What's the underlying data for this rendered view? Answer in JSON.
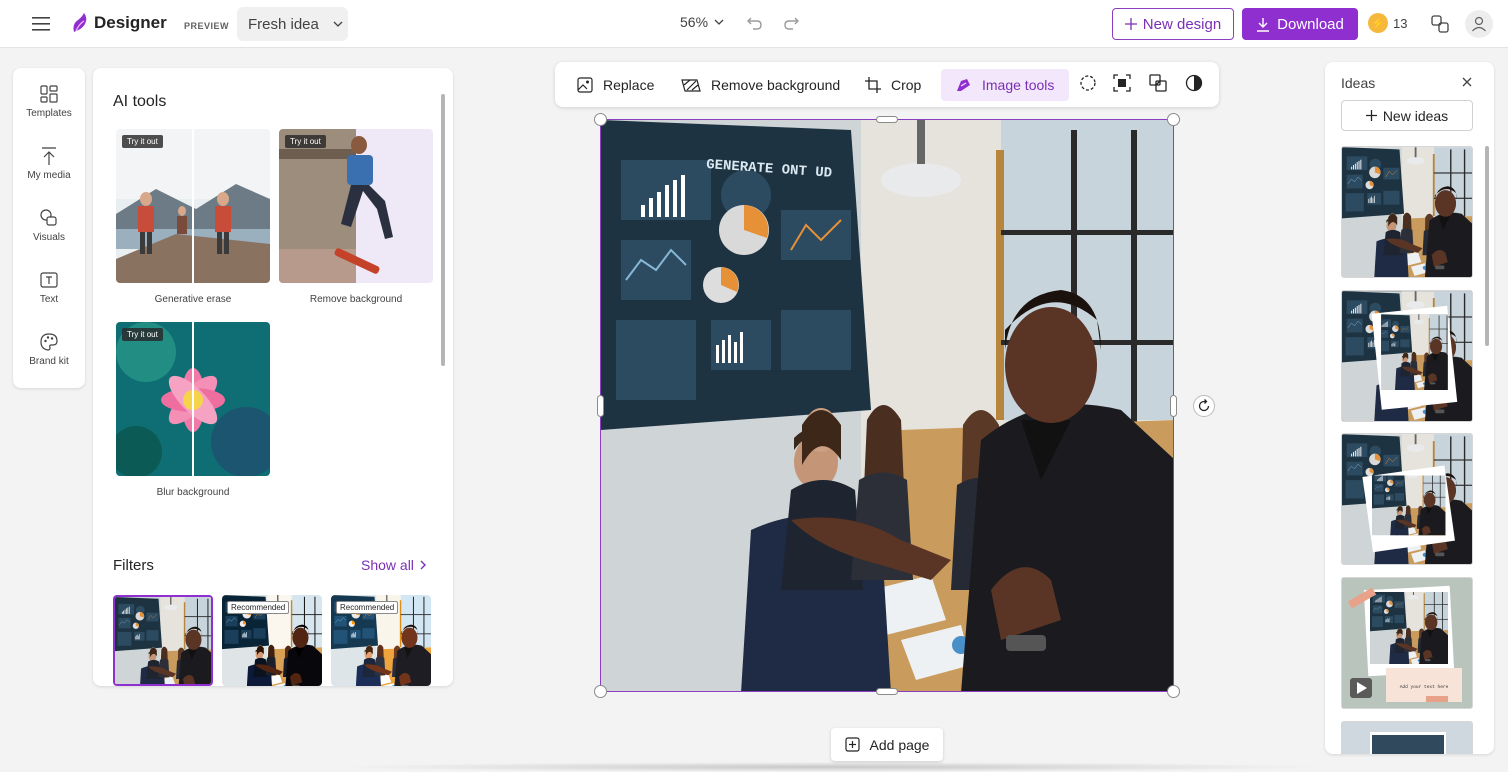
{
  "app": {
    "name": "Designer",
    "badge": "PREVIEW",
    "design_name": "Fresh idea",
    "zoom": "56%"
  },
  "header": {
    "new_design": "New design",
    "download": "Download",
    "coins": "13"
  },
  "leftnav": {
    "items": [
      {
        "label": "Templates",
        "icon": "templates-icon"
      },
      {
        "label": "My media",
        "icon": "upload-icon"
      },
      {
        "label": "Visuals",
        "icon": "shapes-icon"
      },
      {
        "label": "Text",
        "icon": "text-icon"
      },
      {
        "label": "Brand kit",
        "icon": "palette-icon"
      }
    ]
  },
  "ai_tools": {
    "title": "AI tools",
    "try_label": "Try it out",
    "tools": [
      {
        "label": "Generative erase"
      },
      {
        "label": "Remove background"
      },
      {
        "label": "Blur background"
      }
    ]
  },
  "filters": {
    "title": "Filters",
    "show_all": "Show all",
    "badges": [
      "Recommended",
      "Recommended"
    ]
  },
  "toolbar": {
    "replace": "Replace",
    "remove_background": "Remove background",
    "crop": "Crop",
    "image_tools": "Image tools"
  },
  "canvas": {
    "screen_text": "GENERATE ONT UD"
  },
  "add_page": "Add page",
  "ideas": {
    "title": "Ideas",
    "new_ideas": "New ideas",
    "card_text": "Add your text here"
  },
  "colors": {
    "accent": "#8f2fd0",
    "accent_text": "#7a2fb5",
    "active_bg": "#f3e8fb"
  }
}
